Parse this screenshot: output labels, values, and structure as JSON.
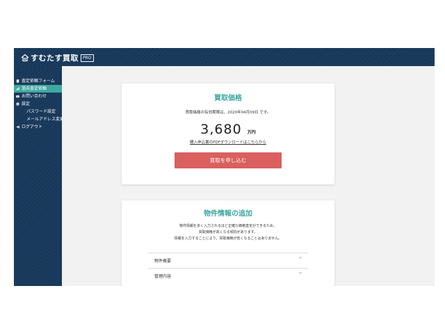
{
  "app": {
    "brand": "すむたす買取",
    "tag": "PRO"
  },
  "sidebar": {
    "items": [
      {
        "label": "査定依頼フォーム",
        "icon": "document-icon"
      },
      {
        "label": "過去査定依頼",
        "icon": "chart-icon",
        "active": true
      },
      {
        "label": "お問い合わせ",
        "icon": "mail-icon"
      },
      {
        "label": "設定",
        "icon": "gear-icon"
      },
      {
        "label": "パスワード設定"
      },
      {
        "label": "メールアドレス変更"
      },
      {
        "label": "ログアウト",
        "icon": "logout-icon"
      }
    ]
  },
  "price_card": {
    "title": "買取価格",
    "deadline": "買取価格の有効期限は、2020年04月09日 です。",
    "price": "3,680",
    "unit": "万円",
    "pdf_link": "購入申込書のPDFダウンロードはこちらから",
    "apply_button": "買取を申し込む"
  },
  "info_card": {
    "title": "物件情報の追加",
    "desc1": "物件情報を多く入力されるほど正確な価格査定ができるため、",
    "desc2": "買取価格が高くなる傾向があります。",
    "desc3": "情報を入力することにより、買取価格が低くなることはありません。",
    "accordions": [
      {
        "label": "物件概要"
      },
      {
        "label": "管理内容"
      }
    ]
  },
  "colors": {
    "navy": "#17385a",
    "teal": "#3fa8a0",
    "button": "#d9605e"
  }
}
